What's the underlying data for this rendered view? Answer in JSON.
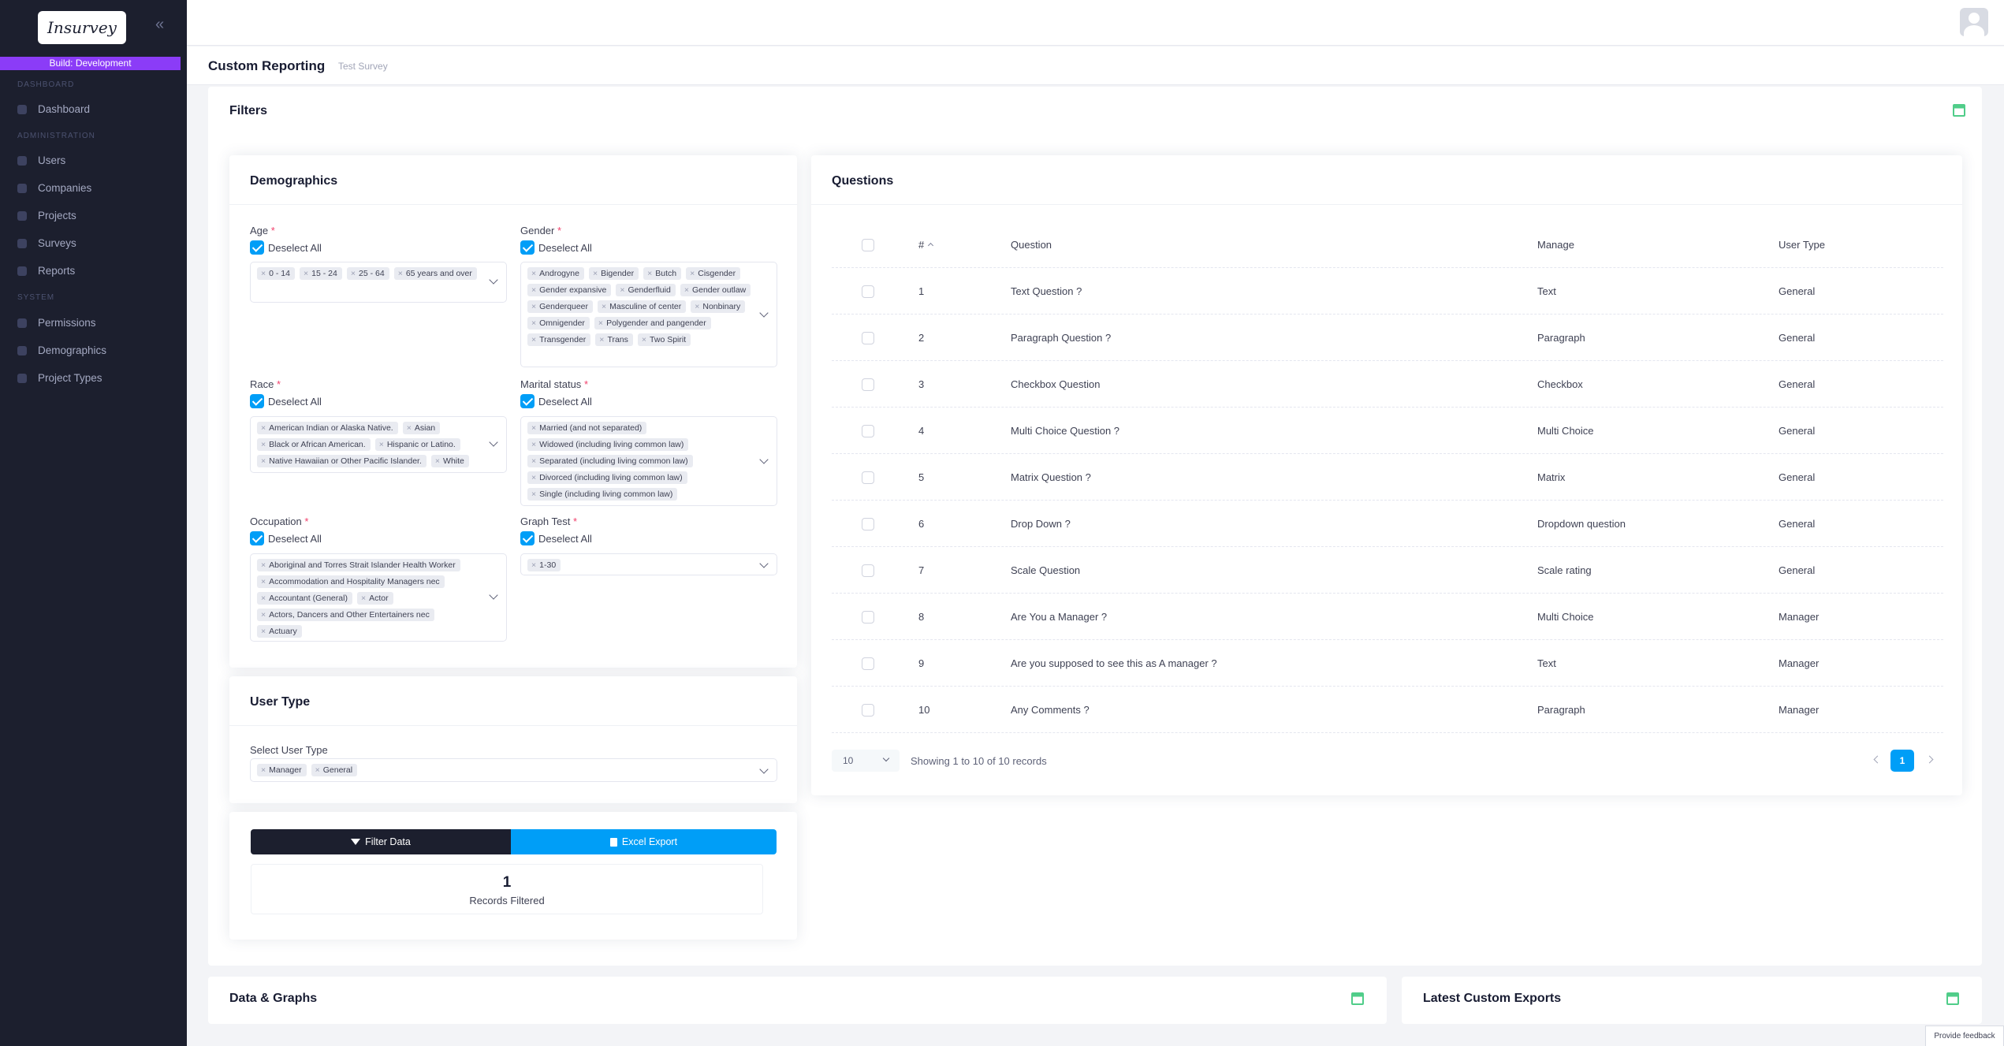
{
  "sidebar": {
    "logo": "Insurvey",
    "build": "Build: Development",
    "sections": {
      "dashboard": "DASHBOARD",
      "administration": "ADMINISTRATION",
      "system": "SYSTEM"
    },
    "items": {
      "dashboard": "Dashboard",
      "users": "Users",
      "companies": "Companies",
      "projects": "Projects",
      "surveys": "Surveys",
      "reports": "Reports",
      "permissions": "Permissions",
      "demographics": "Demographics",
      "project_types": "Project Types"
    }
  },
  "header": {
    "title": "Custom Reporting",
    "subtitle": "Test Survey"
  },
  "filters": {
    "title": "Filters",
    "demographics": {
      "title": "Demographics",
      "deselect_label": "Deselect All",
      "age": {
        "label": "Age",
        "tags": [
          "0 - 14",
          "15 - 24",
          "25 - 64",
          "65 years and over"
        ]
      },
      "gender": {
        "label": "Gender",
        "tags": [
          "Androgyne",
          "Bigender",
          "Butch",
          "Cisgender",
          "Gender expansive",
          "Genderfluid",
          "Gender outlaw",
          "Genderqueer",
          "Masculine of center",
          "Nonbinary",
          "Omnigender",
          "Polygender and pangender",
          "Transgender",
          "Trans",
          "Two Spirit"
        ]
      },
      "race": {
        "label": "Race",
        "tags": [
          "American Indian or Alaska Native.",
          "Asian",
          "Black or African American.",
          "Hispanic or Latino.",
          "Native Hawaiian or Other Pacific Islander.",
          "White"
        ]
      },
      "marital": {
        "label": "Marital status",
        "tags": [
          "Married (and not separated)",
          "Widowed (including living common law)",
          "Separated (including living common law)",
          "Divorced (including living common law)",
          "Single (including living common law)"
        ]
      },
      "occupation": {
        "label": "Occupation",
        "tags": [
          "Aboriginal and Torres Strait Islander Health Worker",
          "Accommodation and Hospitality Managers nec",
          "Accountant (General)",
          "Actor",
          "Actors, Dancers and Other Entertainers nec",
          "Actuary"
        ]
      },
      "graph": {
        "label": "Graph Test",
        "tags": [
          "1-30"
        ]
      }
    },
    "user_type": {
      "title": "User Type",
      "select_label": "Select User Type",
      "tags": [
        "Manager",
        "General"
      ]
    },
    "actions": {
      "filter": "Filter Data",
      "export": "Excel Export",
      "records_count": "1",
      "records_label": "Records Filtered"
    }
  },
  "questions": {
    "title": "Questions",
    "headers": {
      "num": "#",
      "question": "Question",
      "manage": "Manage",
      "user_type": "User Type"
    },
    "rows": [
      {
        "num": "1",
        "question": "Text Question ?",
        "manage": "Text",
        "user_type": "General"
      },
      {
        "num": "2",
        "question": "Paragraph Question ?",
        "manage": "Paragraph",
        "user_type": "General"
      },
      {
        "num": "3",
        "question": "Checkbox Question",
        "manage": "Checkbox",
        "user_type": "General"
      },
      {
        "num": "4",
        "question": "Multi Choice Question ?",
        "manage": "Multi Choice",
        "user_type": "General"
      },
      {
        "num": "5",
        "question": "Matrix Question ?",
        "manage": "Matrix",
        "user_type": "General"
      },
      {
        "num": "6",
        "question": "Drop Down ?",
        "manage": "Dropdown question",
        "user_type": "General"
      },
      {
        "num": "7",
        "question": "Scale Question",
        "manage": "Scale rating",
        "user_type": "General"
      },
      {
        "num": "8",
        "question": "Are You a Manager ?",
        "manage": "Multi Choice",
        "user_type": "Manager"
      },
      {
        "num": "9",
        "question": "Are you supposed to see this as A manager ?",
        "manage": "Text",
        "user_type": "Manager"
      },
      {
        "num": "10",
        "question": "Any Comments ?",
        "manage": "Paragraph",
        "user_type": "Manager"
      }
    ],
    "page_size": "10",
    "showing": "Showing 1 to 10 of 10 records",
    "current_page": "1"
  },
  "bottom": {
    "data_graphs": "Data & Graphs",
    "latest_exports": "Latest Custom Exports"
  },
  "feedback": "Provide feedback",
  "colors": {
    "primary": "#009ef7",
    "sidebar": "#1c1f2e",
    "build": "#8b3cf7",
    "accent_green": "#50cd89"
  }
}
